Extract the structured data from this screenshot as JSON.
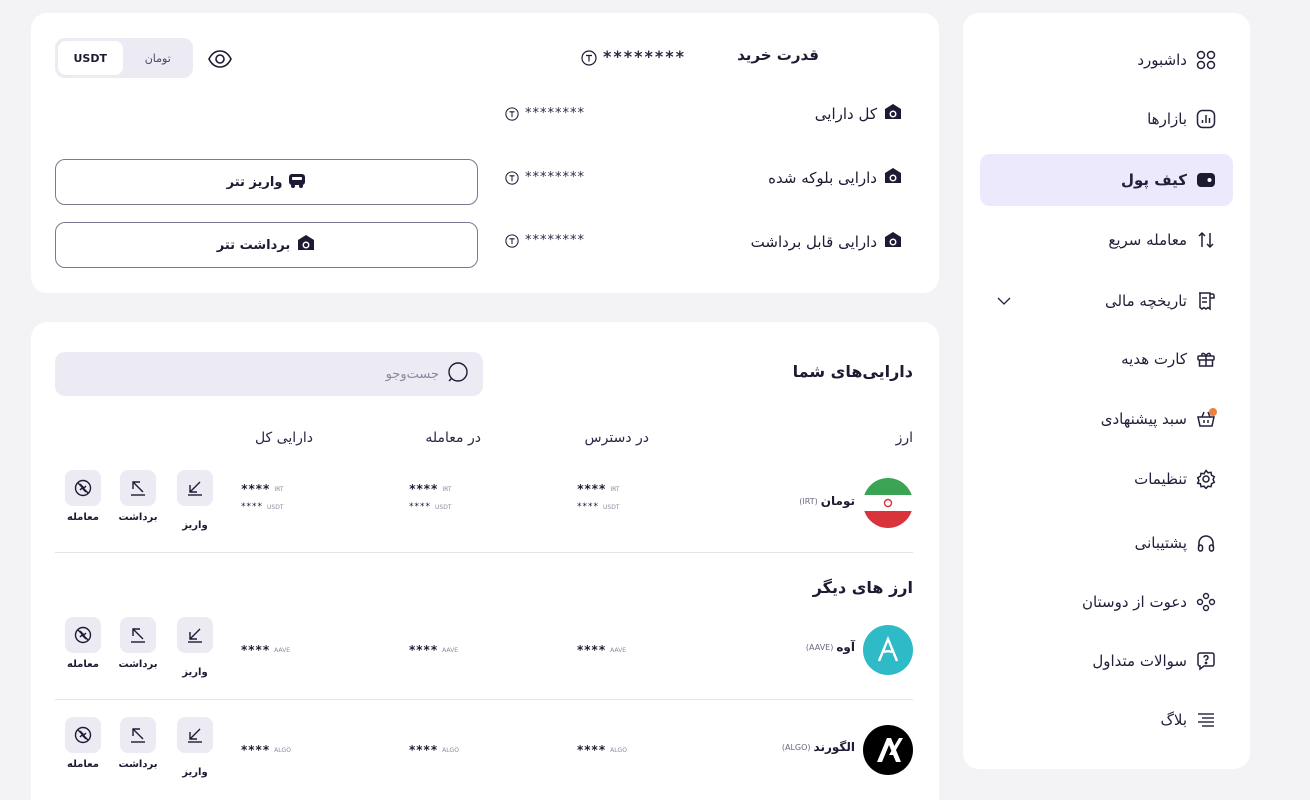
{
  "sidebar": {
    "items": [
      {
        "label": "داشبورد",
        "icon": "dashboard-icon"
      },
      {
        "label": "بازارها",
        "icon": "markets-icon"
      },
      {
        "label": "کیف پول",
        "icon": "wallet-icon",
        "active": true
      },
      {
        "label": "معامله سریع",
        "icon": "swap-arrows-icon"
      },
      {
        "label": "تاریخچه مالی",
        "icon": "receipt-icon",
        "expandable": true
      },
      {
        "label": "کارت هدیه",
        "icon": "gift-icon"
      },
      {
        "label": "سبد پیشنهادی",
        "icon": "basket-icon",
        "badge": true
      },
      {
        "label": "تنظیمات",
        "icon": "gear-icon"
      },
      {
        "label": "پشتیبانی",
        "icon": "headset-icon"
      },
      {
        "label": "دعوت از دوستان",
        "icon": "people-icon"
      },
      {
        "label": "سوالات متداول",
        "icon": "question-bubble-icon"
      },
      {
        "label": "بلاگ",
        "icon": "lines-icon"
      }
    ]
  },
  "summary": {
    "purchase_power_label": "قدرت خرید",
    "purchase_power_value": "********",
    "currency_options": [
      "USDT",
      "تومان"
    ],
    "selected_currency": "USDT",
    "total_assets_label": "کل دارایی",
    "total_assets_value": "********",
    "blocked_assets_label": "دارایی بلوکه شده",
    "blocked_assets_value": "********",
    "withdrawable_assets_label": "دارایی قابل برداشت",
    "withdrawable_assets_value": "********",
    "deposit_button": "واریز تتر",
    "withdraw_button": "برداشت تتر"
  },
  "assets": {
    "title": "دارایی‌های شما",
    "search_placeholder": "جست‌وجو",
    "search_value": "",
    "columns": {
      "currency": "ارز",
      "available": "در دسترس",
      "in_trade": "در معامله",
      "total": "دارایی کل"
    },
    "action_labels": {
      "deposit": "واریز",
      "withdraw": "برداشت",
      "trade": "معامله"
    },
    "toman_row": {
      "name": "تومان",
      "symbol": "(IRT)",
      "available": "****",
      "available_unit": "IRT",
      "available_sub": "****",
      "available_sub_unit": "USDT",
      "in_trade": "****",
      "in_trade_unit": "IRT",
      "in_trade_sub": "****",
      "in_trade_sub_unit": "USDT",
      "total": "****",
      "total_unit": "IRT",
      "total_sub": "****",
      "total_sub_unit": "USDT"
    },
    "other_title": "ارز های دیگر",
    "coins": [
      {
        "name": "آوه",
        "symbol": "(AAVE)",
        "available": "****",
        "in_trade": "****",
        "total": "****",
        "unit": "AAVE"
      },
      {
        "name": "الگورند",
        "symbol": "(ALGO)",
        "available": "****",
        "in_trade": "****",
        "total": "****",
        "unit": "ALGO"
      }
    ]
  },
  "colors": {
    "accent": "#ebe9fb",
    "badge": "#f07e3c",
    "aave": "#2ebac6",
    "algo": "#000000"
  }
}
